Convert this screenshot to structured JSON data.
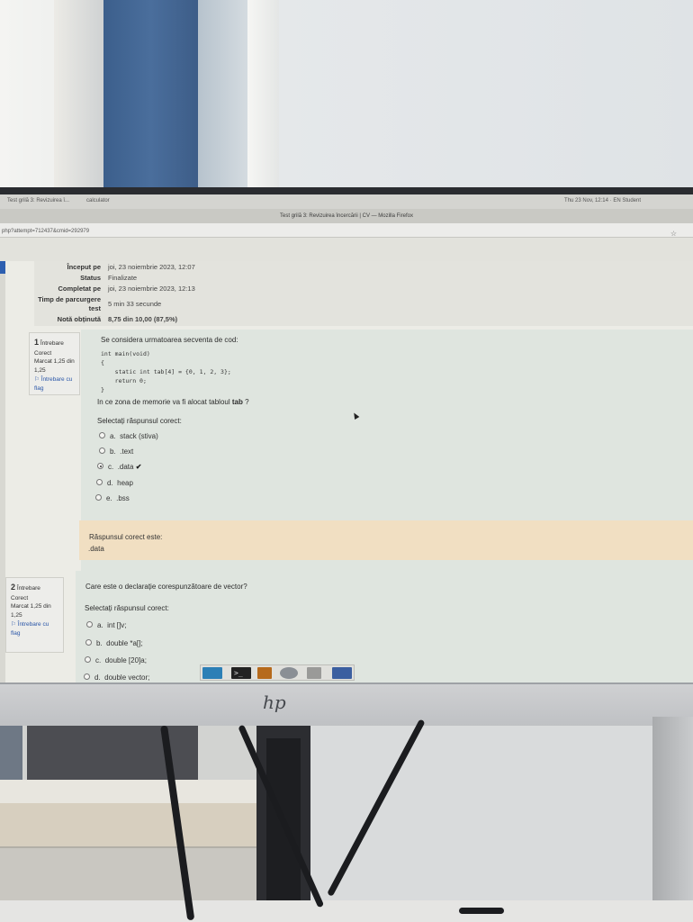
{
  "browser": {
    "os_tabs": [
      "Test grilă 3: Revizuirea î...",
      "calculator"
    ],
    "clock": "Thu 23 Nov, 12:14",
    "user": "EN Student",
    "window_title": "Test grilă 3: Revizuirea încercării | CV — Mozilla Firefox",
    "url": "php?attempt=712437&cmid=292979"
  },
  "summary": {
    "rows": [
      {
        "label": "Început pe",
        "value": "joi, 23 noiembrie 2023, 12:07"
      },
      {
        "label": "Status",
        "value": "Finalizate"
      },
      {
        "label": "Completat pe",
        "value": "joi, 23 noiembrie 2023, 12:13"
      },
      {
        "label": "Timp de parcurgere test",
        "value": "5 min 33 secunde"
      },
      {
        "label": "Notă obținută",
        "value": "8,75 din 10,00 (87,5%)"
      }
    ]
  },
  "question1": {
    "info": {
      "number": "1",
      "word": "Întrebare",
      "state": "Corect",
      "mark": "Marcat 1,25 din 1,25",
      "flag": "Întrebare cu flag"
    },
    "intro": "Se considera urmatoarea secventa de cod:",
    "code": "int main(void)\n{\n    static int tab[4] = {0, 1, 2, 3};\n    return 0;\n}",
    "question_before": "In ce zona de memorie va fi alocat tabloul ",
    "question_bold": "tab",
    "question_after": " ?",
    "prompt": "Selectați răspunsul corect:",
    "options": [
      {
        "letter": "a.",
        "text": "stack (stiva)"
      },
      {
        "letter": "b.",
        "text": ".text"
      },
      {
        "letter": "c.",
        "text": ".data"
      },
      {
        "letter": "d.",
        "text": "heap"
      },
      {
        "letter": "e.",
        "text": ".bss"
      }
    ],
    "selected": "c.",
    "correct_mark": "✔"
  },
  "feedback1": {
    "label": "Răspunsul corect este:",
    "answer": ".data"
  },
  "question2": {
    "info": {
      "number": "2",
      "word": "Întrebare",
      "state": "Corect",
      "mark": "Marcat 1,25 din 1,25",
      "flag": "Întrebare cu flag"
    },
    "question": "Care este o declarație corespunzătoare de vector?",
    "prompt": "Selectați răspunsul corect:",
    "options": [
      {
        "letter": "a.",
        "text": "int []v;"
      },
      {
        "letter": "b.",
        "text": "double *a[];"
      },
      {
        "letter": "c.",
        "text": "double [20]a;"
      },
      {
        "letter": "d.",
        "text": "double vector;"
      }
    ]
  },
  "monitor": {
    "brand": "hp"
  },
  "colors": {
    "question_bg": "#dfe5df",
    "feedback_bg": "#f1dfc2",
    "curtain": "#4a6e9c"
  }
}
